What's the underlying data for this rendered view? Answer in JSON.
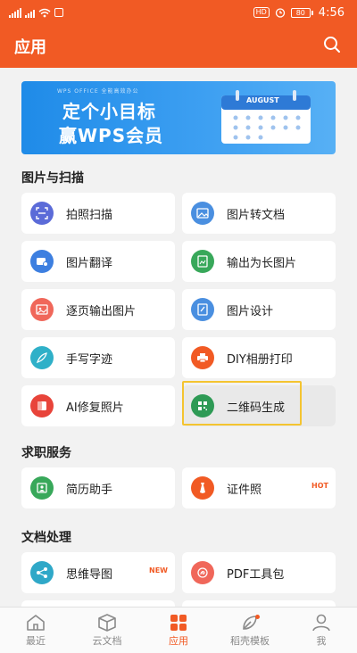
{
  "status_bar": {
    "hd_badge": "HD",
    "battery": "80",
    "time": "4:56"
  },
  "header": {
    "title": "应用",
    "search_icon": "search-icon"
  },
  "banner": {
    "small_text": "WPS OFFICE 全能高效办公",
    "line1": "定个小目标",
    "line2": "赢WPS会员",
    "calendar_month": "AUGUST"
  },
  "sections": [
    {
      "title": "图片与扫描",
      "items": [
        {
          "label": "拍照扫描",
          "icon": "scan-icon",
          "color": "#5b6bd8"
        },
        {
          "label": "图片转文档",
          "icon": "image-icon",
          "color": "#4a8fe0"
        },
        {
          "label": "图片翻译",
          "icon": "translate-icon",
          "color": "#3d7fe0"
        },
        {
          "label": "输出为长图片",
          "icon": "long-image-icon",
          "color": "#38a85a"
        },
        {
          "label": "逐页输出图片",
          "icon": "pages-icon",
          "color": "#f0675a"
        },
        {
          "label": "图片设计",
          "icon": "design-icon",
          "color": "#4a8fe0"
        },
        {
          "label": "手写字迹",
          "icon": "pen-icon",
          "color": "#2fb0c8"
        },
        {
          "label": "DIY相册打印",
          "icon": "printer-icon",
          "color": "#f15a24"
        },
        {
          "label": "AI修复照片",
          "icon": "repair-icon",
          "color": "#e8443a"
        },
        {
          "label": "二维码生成",
          "icon": "qrcode-icon",
          "color": "#2e9a55"
        }
      ]
    },
    {
      "title": "求职服务",
      "items": [
        {
          "label": "简历助手",
          "icon": "resume-icon",
          "color": "#38a85a"
        },
        {
          "label": "证件照",
          "icon": "id-photo-icon",
          "color": "#f15a24",
          "tag": "HOT"
        }
      ]
    },
    {
      "title": "文档处理",
      "items": [
        {
          "label": "思维导图",
          "icon": "mindmap-icon",
          "color": "#2fa8c8",
          "tag": "NEW"
        },
        {
          "label": "PDF工具包",
          "icon": "pdf-icon",
          "color": "#f0675a"
        }
      ]
    }
  ],
  "bottom_nav": [
    {
      "label": "最近",
      "icon": "home-icon"
    },
    {
      "label": "云文档",
      "icon": "cloud-box-icon"
    },
    {
      "label": "应用",
      "icon": "apps-icon",
      "active": true
    },
    {
      "label": "稻壳模板",
      "icon": "leaf-icon",
      "dot": true
    },
    {
      "label": "我",
      "icon": "person-icon"
    }
  ],
  "colors": {
    "accent": "#f15a24",
    "background": "#f2f2f2"
  }
}
